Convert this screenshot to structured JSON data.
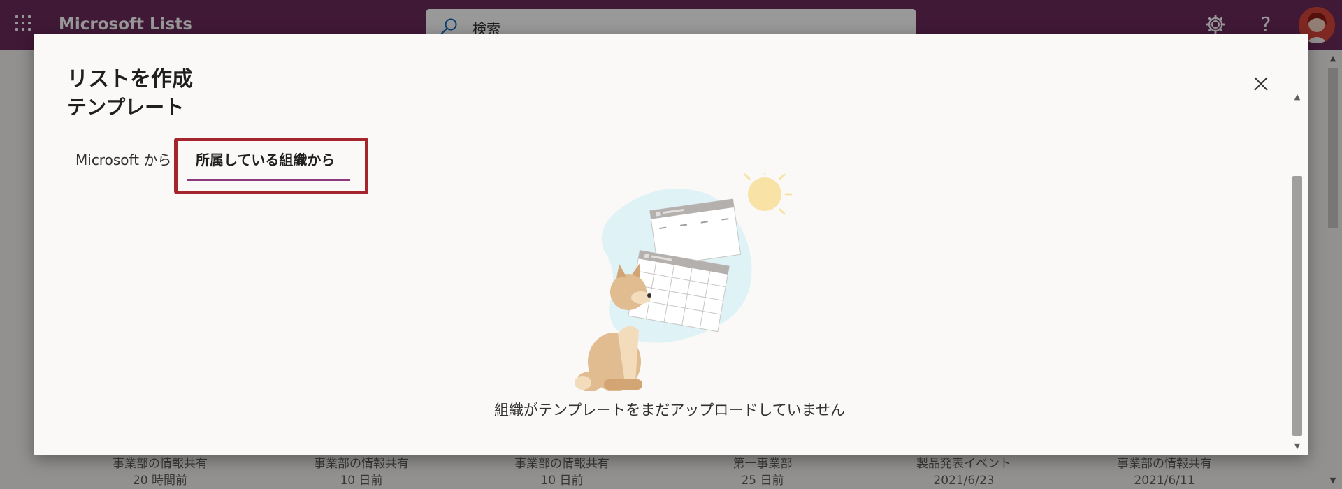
{
  "suite_header": {
    "app_title": "Microsoft Lists",
    "search_placeholder": "検索",
    "settings_icon": "gear-icon",
    "help_label": "?",
    "brand_color": "#6b2a5c"
  },
  "background_cards": [
    {
      "title": "事業部の情報共有",
      "meta": "20 時間前"
    },
    {
      "title": "事業部の情報共有",
      "meta": "10 日前"
    },
    {
      "title": "事業部の情報共有",
      "meta": "10 日前"
    },
    {
      "title": "第一事業部",
      "meta": "25 日前"
    },
    {
      "title": "製品発表イベント",
      "meta": "2021/6/23"
    },
    {
      "title": "事業部の情報共有",
      "meta": "2021/6/11"
    }
  ],
  "dialog": {
    "title": "リストを作成",
    "subtitle": "テンプレート",
    "close_icon": "close-icon",
    "tabs": [
      {
        "label": "Microsoft から",
        "selected": false
      },
      {
        "label": "所属している組織から",
        "selected": true
      }
    ],
    "empty_message": "組織がテンプレートをまだアップロードしていません",
    "highlight_color": "#a4262c",
    "accent_color": "#8a3a7d"
  }
}
